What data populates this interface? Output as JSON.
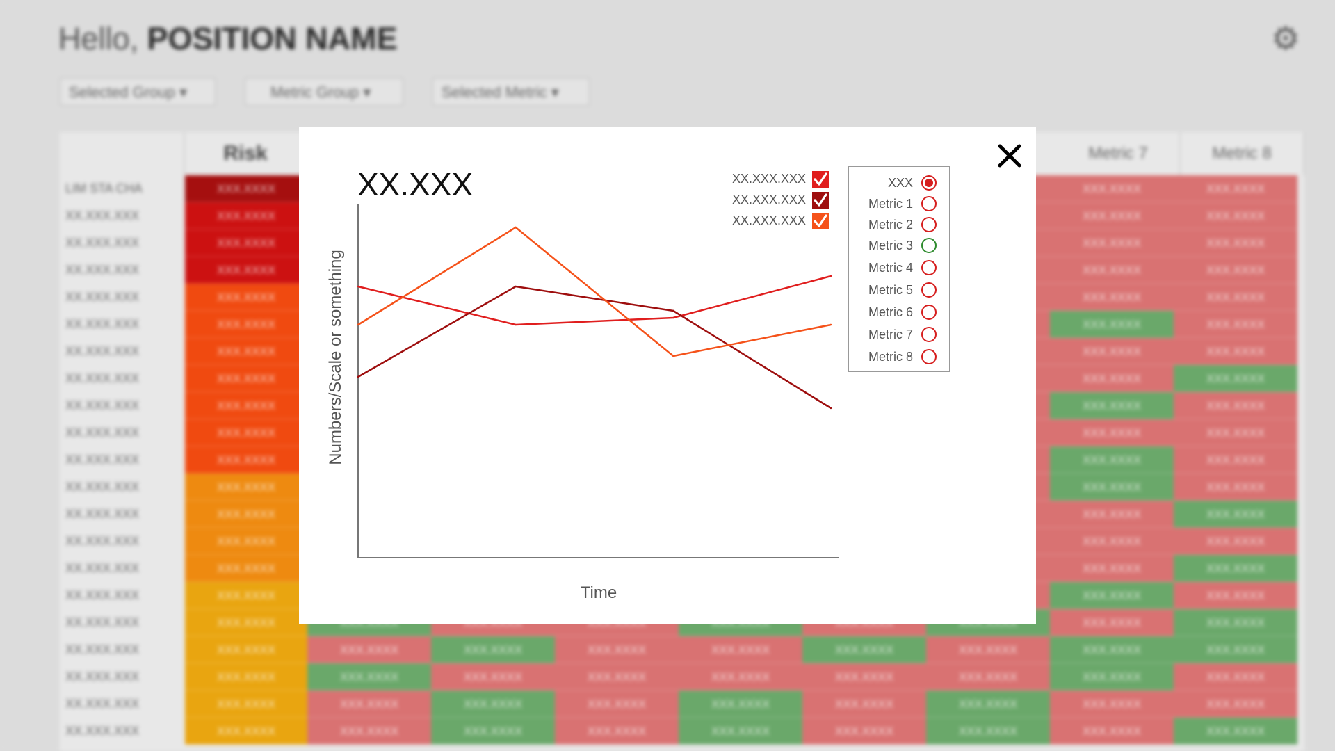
{
  "dashboard": {
    "greeting_prefix": "Hello,",
    "greeting_name": "POSITION NAME",
    "filters": [
      "Selected Group",
      "Metric Group",
      "Selected Metric"
    ],
    "risk_header": "Risk",
    "metric_headers": [
      "Metric 7",
      "Metric 8"
    ],
    "first_row_label": "LIM STA CHA",
    "row_label": "XX.XXX.XXX",
    "cell_value": "XXX.XXXX"
  },
  "modal": {
    "title": "XX.XXX",
    "close_icon": "close-icon",
    "legend": [
      {
        "label": "XX.XXX.XXX",
        "color": "#e01e1e",
        "checked": true
      },
      {
        "label": "XX.XXX.XXX",
        "color": "#9e0e0e",
        "checked": true
      },
      {
        "label": "XX.XXX.XXX",
        "color": "#f5521a",
        "checked": true
      }
    ],
    "metrics": [
      {
        "label": "XXX",
        "selected": true,
        "color": "#d61e1e"
      },
      {
        "label": "Metric 1",
        "selected": false,
        "color": "#d61e1e"
      },
      {
        "label": "Metric 2",
        "selected": false,
        "color": "#d61e1e"
      },
      {
        "label": "Metric 3",
        "selected": false,
        "color": "#2e8b2e"
      },
      {
        "label": "Metric 4",
        "selected": false,
        "color": "#d61e1e"
      },
      {
        "label": "Metric 5",
        "selected": false,
        "color": "#d61e1e"
      },
      {
        "label": "Metric 6",
        "selected": false,
        "color": "#d61e1e"
      },
      {
        "label": "Metric 7",
        "selected": false,
        "color": "#d61e1e"
      },
      {
        "label": "Metric 8",
        "selected": false,
        "color": "#d61e1e"
      }
    ]
  },
  "chart_data": {
    "type": "line",
    "title": "XX.XXX",
    "xlabel": "Time",
    "ylabel": "Numbers/Scale or something",
    "x": [
      0,
      1,
      2,
      3
    ],
    "xlim": [
      0,
      3
    ],
    "ylim": [
      0,
      100
    ],
    "grid": false,
    "legend": "top-right",
    "series": [
      {
        "color": "#e01e1e",
        "values": [
          78,
          67,
          69,
          81
        ]
      },
      {
        "color": "#9e0e0e",
        "values": [
          52,
          78,
          71,
          43
        ]
      },
      {
        "color": "#f5521a",
        "values": [
          67,
          95,
          58,
          67
        ]
      }
    ]
  }
}
